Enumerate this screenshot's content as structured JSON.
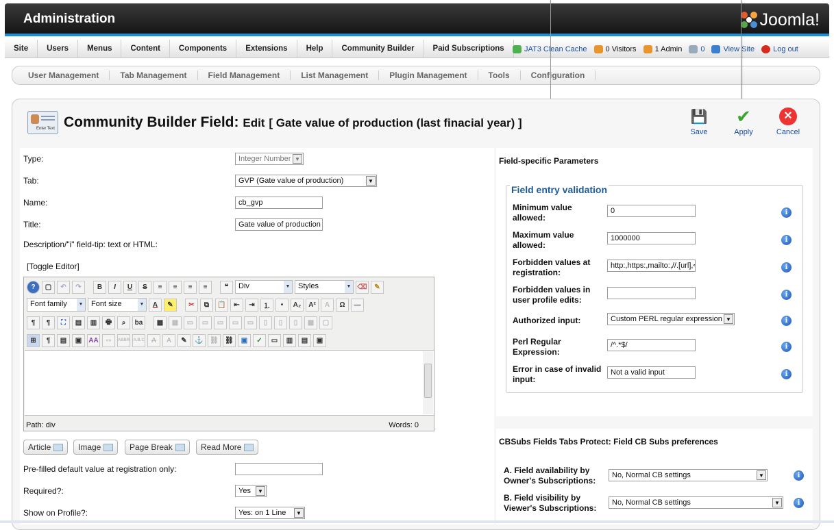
{
  "header": {
    "title": "Administration",
    "logo_text": "Joomla!"
  },
  "menu": [
    "Site",
    "Users",
    "Menus",
    "Content",
    "Components",
    "Extensions",
    "Help",
    "Community Builder",
    "Paid Subscriptions"
  ],
  "status": {
    "cache": "JAT3 Clean Cache",
    "visitors": "0 Visitors",
    "admins": "1 Admin",
    "messages": "0",
    "view_site": "View Site",
    "logout": "Log out"
  },
  "submenu": [
    "User Management",
    "Tab Management",
    "Field Management",
    "List Management",
    "Plugin Management",
    "Tools",
    "Configuration"
  ],
  "page": {
    "title": "Community Builder Field:",
    "mode": "Edit",
    "field_name": "[ Gate value of production (last finacial year) ]",
    "icon_text": "Enter Text"
  },
  "toolbar": {
    "save": "Save",
    "apply": "Apply",
    "cancel": "Cancel"
  },
  "form": {
    "type_label": "Type:",
    "type_value": "Integer Number",
    "tab_label": "Tab:",
    "tab_value": "GVP (Gate value of production)",
    "name_label": "Name:",
    "name_value": "cb_gvp",
    "title_label": "Title:",
    "title_value": "Gate value of production (",
    "desc_label": "Description/\"i\" field-tip: text or HTML:",
    "toggle_editor": "[Toggle Editor]",
    "prefilled_label": "Pre-filled default value at registration only:",
    "prefilled_value": "",
    "required_label": "Required?:",
    "required_value": "Yes",
    "profile_label": "Show on Profile?:",
    "profile_value": "Yes: on 1 Line"
  },
  "editor": {
    "format_select": "Div",
    "styles_select": "Styles",
    "font_family": "Font family",
    "font_size": "Font size",
    "path": "Path:  div",
    "words": "Words: 0"
  },
  "editor_buttons": {
    "article": "Article",
    "image": "Image",
    "page_break": "Page Break",
    "read_more": "Read More"
  },
  "params": {
    "heading": "Field-specific Parameters",
    "legend": "Field entry validation",
    "rows": [
      {
        "label": "Minimum value allowed:",
        "value": "0"
      },
      {
        "label": "Maximum value allowed:",
        "value": "1000000"
      },
      {
        "label": "Forbidden values at registration:",
        "value": "http:,https:,mailto:,//.[url],<a"
      },
      {
        "label": "Forbidden values in user profile edits:",
        "value": ""
      },
      {
        "label": "Authorized input:",
        "value": "Custom PERL regular expression"
      },
      {
        "label": "Perl Regular Expression:",
        "value": "/^.*$/"
      },
      {
        "label": "Error in case of invalid input:",
        "value": "Not a valid input"
      }
    ]
  },
  "cbsubs": {
    "heading": "CBSubs Fields Tabs Protect: Field CB Subs preferences",
    "availability_label": "A. Field availability by Owner's Subscriptions:",
    "availability_value": "No, Normal CB settings",
    "visibility_label": "B. Field visibility by Viewer's Subscriptions:",
    "visibility_value": "No, Normal CB settings"
  }
}
